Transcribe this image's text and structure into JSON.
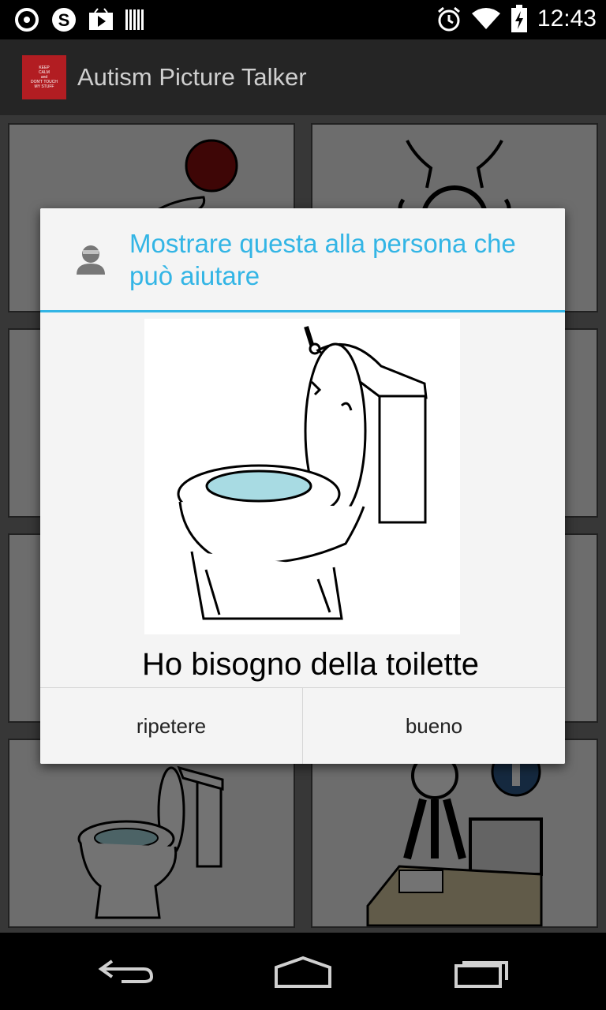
{
  "status_bar": {
    "time": "12:43",
    "left_icons": [
      "sync-icon",
      "skype-icon",
      "play-store-icon",
      "barcode-icon"
    ],
    "right_icons": [
      "alarm-icon",
      "wifi-icon",
      "battery-charging-icon"
    ]
  },
  "action_bar": {
    "title": "Autism Picture Talker",
    "icon_text": [
      "KEEP",
      "CALM",
      "and",
      "DON'T TOUCH",
      "MY STUFF"
    ]
  },
  "grid": {
    "tiles": [
      {
        "icon": "stop-hand-icon"
      },
      {
        "icon": "hands-up-icon"
      },
      {
        "icon": "blank-tile"
      },
      {
        "icon": "blank-tile"
      },
      {
        "icon": "blank-tile"
      },
      {
        "icon": "blank-tile"
      },
      {
        "icon": "toilet-icon"
      },
      {
        "icon": "info-desk-icon"
      }
    ]
  },
  "dialog": {
    "title": "Mostrare questa alla persona che può aiutare",
    "icon": "person-icon",
    "picture": "toilet-icon",
    "phrase": "Ho bisogno della toilette",
    "buttons": {
      "repeat": "ripetere",
      "ok": "bueno"
    }
  },
  "nav_bar": {
    "buttons": [
      "back-icon",
      "home-icon",
      "recents-icon"
    ]
  },
  "colors": {
    "accent": "#33b5e5",
    "action_bar": "#252525",
    "dialog_bg": "#f4f4f4"
  }
}
